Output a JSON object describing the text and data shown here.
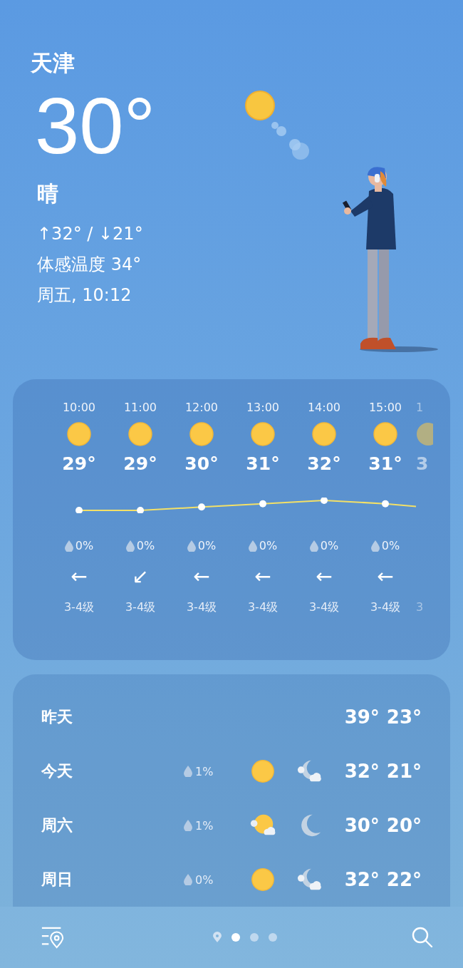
{
  "city": "天津",
  "current": {
    "temperature": "30°",
    "condition": "晴",
    "high_low": "↑32° / ↓21°",
    "feels_like": "体感温度 34°",
    "datetime": "周五, 10:12"
  },
  "hourly": [
    {
      "time": "10:00",
      "temp": "29°",
      "precip": "0%",
      "wind_arrow": "←",
      "wind": "3-4级"
    },
    {
      "time": "11:00",
      "temp": "29°",
      "precip": "0%",
      "wind_arrow": "↙",
      "wind": "3-4级"
    },
    {
      "time": "12:00",
      "temp": "30°",
      "precip": "0%",
      "wind_arrow": "←",
      "wind": "3-4级"
    },
    {
      "time": "13:00",
      "temp": "31°",
      "precip": "0%",
      "wind_arrow": "←",
      "wind": "3-4级"
    },
    {
      "time": "14:00",
      "temp": "32°",
      "precip": "0%",
      "wind_arrow": "←",
      "wind": "3-4级"
    },
    {
      "time": "15:00",
      "temp": "31°",
      "precip": "0%",
      "wind_arrow": "←",
      "wind": "3-4级"
    }
  ],
  "hourly_cut": {
    "time": "1",
    "temp": "3",
    "wind": "3"
  },
  "daily": [
    {
      "day": "昨天",
      "high": "39°",
      "low": "23°"
    },
    {
      "day": "今天",
      "precip": "1%",
      "day_sky": {
        "kind": "sun"
      },
      "night_sky": {
        "kind": "moon-cloud"
      },
      "high": "32°",
      "low": "21°"
    },
    {
      "day": "周六",
      "precip": "1%",
      "day_sky": {
        "kind": "sun-cloud"
      },
      "night_sky": {
        "kind": "moon"
      },
      "high": "30°",
      "low": "20°"
    },
    {
      "day": "周日",
      "precip": "0%",
      "day_sky": {
        "kind": "sun"
      },
      "night_sky": {
        "kind": "moon-cloud"
      },
      "high": "32°",
      "low": "22°"
    }
  ],
  "pages": [
    {
      "kind": "location",
      "selected": false
    },
    {
      "kind": "dot",
      "selected": true
    },
    {
      "kind": "dot",
      "selected": false
    },
    {
      "kind": "dot",
      "selected": false
    }
  ]
}
